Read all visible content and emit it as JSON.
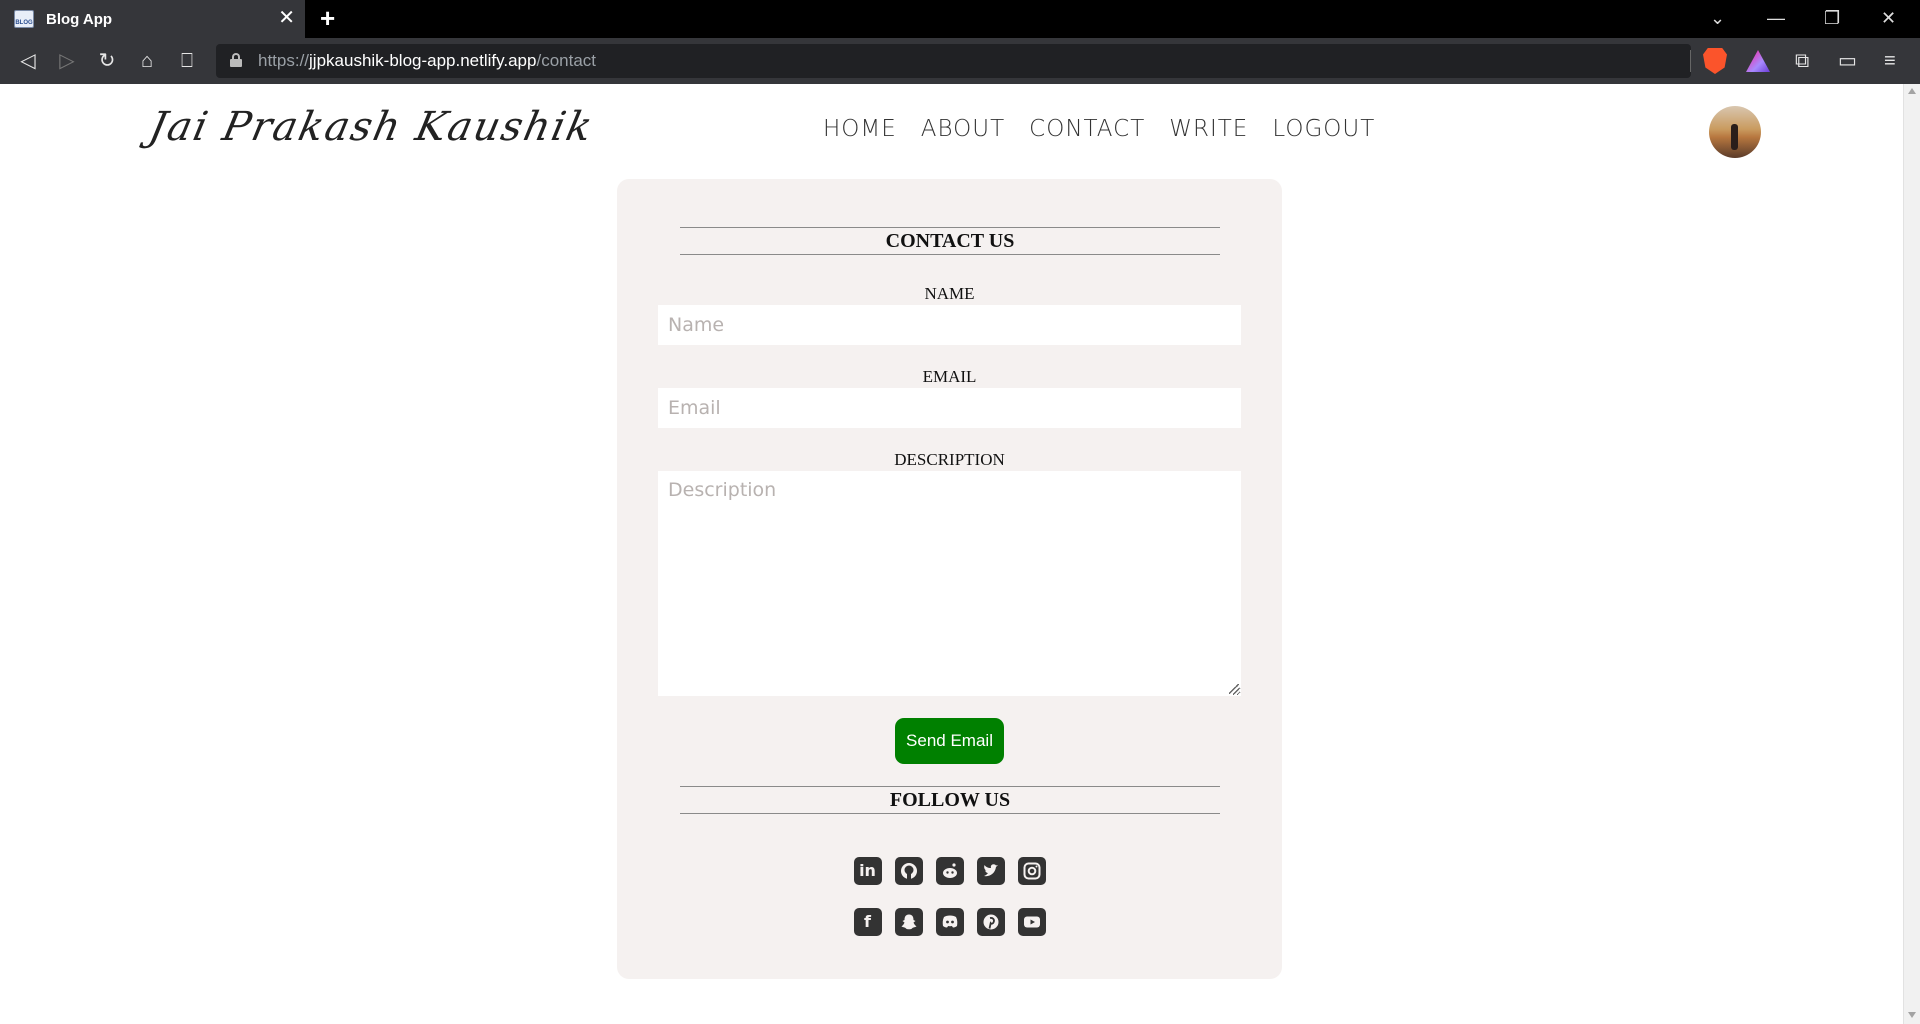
{
  "browser": {
    "tab_title": "Blog App",
    "favicon_text": "BLOG",
    "url_scheme": "https://",
    "url_host": "jjpkaushik-blog-app.netlify.app",
    "url_path": "/contact"
  },
  "header": {
    "logo_text": "Jai Prakash Kaushik",
    "nav": {
      "home": "HOME",
      "about": "ABOUT",
      "contact": "CONTACT",
      "write": "WRITE",
      "logout": "LOGOUT"
    }
  },
  "contact_form": {
    "title": "CONTACT US",
    "name_label": "NAME",
    "name_placeholder": "Name",
    "email_label": "EMAIL",
    "email_placeholder": "Email",
    "description_label": "DESCRIPTION",
    "description_placeholder": "Description",
    "submit_label": "Send Email",
    "submit_color": "#008000"
  },
  "follow": {
    "title": "FOLLOW US",
    "row1": [
      "linkedin-icon",
      "github-icon",
      "reddit-icon",
      "twitter-icon",
      "instagram-icon"
    ],
    "row2": [
      "facebook-icon",
      "snapchat-icon",
      "discord-icon",
      "pinterest-icon",
      "youtube-icon"
    ]
  },
  "colors": {
    "card_bg": "#f5f1f0",
    "icon": "#333333"
  }
}
